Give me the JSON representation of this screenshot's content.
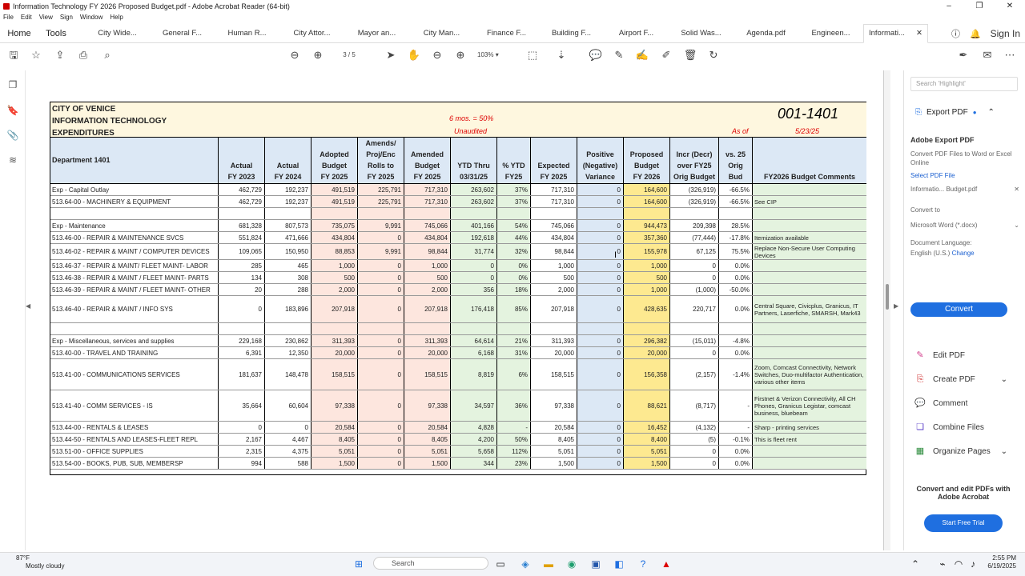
{
  "window": {
    "title": "Information Technology FY 2026 Proposed Budget.pdf - Adobe Acrobat Reader (64-bit)",
    "controls": [
      "–",
      "❐",
      "✕"
    ]
  },
  "menu": [
    "File",
    "Edit",
    "View",
    "Sign",
    "Window",
    "Help"
  ],
  "tabs": {
    "home": "Home",
    "tools": "Tools",
    "items": [
      "City Wide...",
      "General F...",
      "Human R...",
      "City Attor...",
      "Mayor an...",
      "City Man...",
      "Finance F...",
      "Building F...",
      "Airport F...",
      "Solid Was...",
      "Agenda.pdf",
      "Engineen..."
    ],
    "active": "Informati...",
    "sign_in": "Sign In"
  },
  "toolbar": {
    "page_current": "3",
    "page_total": "/ 5",
    "zoom": "103%"
  },
  "right_panel": {
    "search_placeholder": "Search 'Highlight'",
    "export_title": "Export PDF",
    "adobe_export_title": "Adobe Export PDF",
    "adobe_export_desc": "Convert PDF Files to Word or Excel Online",
    "select_file_label": "Select PDF File",
    "selected_file": "Informatio... Budget.pdf",
    "convert_to_label": "Convert to",
    "convert_to_value": "Microsoft Word (*.docx)",
    "doc_lang_label": "Document Language:",
    "doc_lang_value": "English (U.S.)",
    "doc_lang_change": "Change",
    "convert_button": "Convert",
    "tools": [
      "Edit PDF",
      "Create PDF",
      "Comment",
      "Combine Files",
      "Organize Pages"
    ],
    "promo": "Convert and edit PDFs with Adobe Acrobat",
    "trial_button": "Start Free Trial"
  },
  "taskbar": {
    "weather_temp": "87°F",
    "weather_desc": "Mostly cloudy",
    "search": "Search",
    "time": "2:55 PM",
    "date": "6/19/2025"
  },
  "sheet": {
    "org_lines": [
      "CITY OF VENICE",
      "INFORMATION TECHNOLOGY",
      "EXPENDITURES"
    ],
    "half_note": "6 mos. = 50%",
    "unaudited": "Unaudited",
    "dept_code": "001-1401",
    "as_of": "As of",
    "as_of_date": "5/23/25",
    "headers": [
      "Department 1401",
      "Actual\nFY 2023",
      "Actual\nFY 2024",
      "Adopted\nBudget\nFY 2025",
      "Amends/\nProj/Enc\nRolls to\nFY 2025",
      "Amended\nBudget\nFY 2025",
      "YTD Thru\n03/31/25",
      "% YTD\nFY25",
      "Expected\nFY 2025",
      "Positive\n(Negative)\nVariance",
      "Proposed\nBudget\nFY 2026",
      "Incr (Decr)\nover FY25\nOrig Budget",
      "vs. 25\nOrig\nBud",
      "FY2026 Budget Comments"
    ],
    "rows": [
      {
        "cells": [
          "Exp - Capital Outlay",
          "462,729",
          "192,237",
          "491,519",
          "225,791",
          "717,310",
          "263,602",
          "37%",
          "717,310",
          "0",
          "164,600",
          "(326,919)",
          "-66.5%",
          ""
        ]
      },
      {
        "cells": [
          "513.64-00 - MACHINERY & EQUIPMENT",
          "462,729",
          "192,237",
          "491,519",
          "225,791",
          "717,310",
          "263,602",
          "37%",
          "717,310",
          "0",
          "164,600",
          "(326,919)",
          "-66.5%",
          "See CIP"
        ]
      },
      {
        "cells": [
          "",
          "",
          "",
          "",
          "",
          "",
          "",
          "",
          "",
          "",
          "",
          "",
          "",
          ""
        ]
      },
      {
        "cells": [
          "Exp - Maintenance",
          "681,328",
          "807,573",
          "735,075",
          "9,991",
          "745,066",
          "401,166",
          "54%",
          "745,066",
          "0",
          "944,473",
          "209,398",
          "28.5%",
          ""
        ]
      },
      {
        "cells": [
          "513.46-00 - REPAIR & MAINTENANCE SVCS",
          "551,824",
          "471,666",
          "434,804",
          "0",
          "434,804",
          "192,618",
          "44%",
          "434,804",
          "0",
          "357,360",
          "(77,444)",
          "-17.8%",
          "Itemization available"
        ]
      },
      {
        "cells": [
          "513.46-02 - REPAIR & MAINT / COMPUTER DEVICES",
          "109,065",
          "150,950",
          "88,853",
          "9,991",
          "98,844",
          "31,774",
          "32%",
          "98,844",
          "0",
          "155,978",
          "67,125",
          "75.5%",
          "Replace Non-Secure User Computing Devices"
        ]
      },
      {
        "cells": [
          "513.46-37 - REPAIR & MAINT/ FLEET MAINT- LABOR",
          "285",
          "465",
          "1,000",
          "0",
          "1,000",
          "0",
          "0%",
          "1,000",
          "0",
          "1,000",
          "0",
          "0.0%",
          ""
        ]
      },
      {
        "cells": [
          "513.46-38 - REPAIR & MAINT / FLEET MAINT- PARTS",
          "134",
          "308",
          "500",
          "0",
          "500",
          "0",
          "0%",
          "500",
          "0",
          "500",
          "0",
          "0.0%",
          ""
        ]
      },
      {
        "cells": [
          "513.46-39 - REPAIR & MAINT / FLEET MAINT- OTHER",
          "20",
          "288",
          "2,000",
          "0",
          "2,000",
          "356",
          "18%",
          "2,000",
          "0",
          "1,000",
          "(1,000)",
          "-50.0%",
          ""
        ]
      },
      {
        "cells": [
          "513.46-40 - REPAIR & MAINT / INFO SYS",
          "0",
          "183,896",
          "207,918",
          "0",
          "207,918",
          "176,418",
          "85%",
          "207,918",
          "0",
          "428,635",
          "220,717",
          "0.0%",
          "Central Square, Civicplus, Granicus, IT Partners, Laserfiche, SMARSH, Mark43"
        ]
      },
      {
        "cells": [
          "",
          "",
          "",
          "",
          "",
          "",
          "",
          "",
          "",
          "",
          "",
          "",
          "",
          ""
        ]
      },
      {
        "cells": [
          "Exp - Miscellaneous, services and supplies",
          "229,168",
          "230,862",
          "311,393",
          "0",
          "311,393",
          "64,614",
          "21%",
          "311,393",
          "0",
          "296,382",
          "(15,011)",
          "-4.8%",
          ""
        ]
      },
      {
        "cells": [
          "513.40-00 - TRAVEL AND TRAINING",
          "6,391",
          "12,350",
          "20,000",
          "0",
          "20,000",
          "6,168",
          "31%",
          "20,000",
          "0",
          "20,000",
          "0",
          "0.0%",
          ""
        ]
      },
      {
        "cells": [
          "513.41-00 - COMMUNICATIONS SERVICES",
          "181,637",
          "148,478",
          "158,515",
          "0",
          "158,515",
          "8,819",
          "6%",
          "158,515",
          "0",
          "156,358",
          "(2,157)",
          "-1.4%",
          "Zoom, Comcast Connectivity, Network Switches, Duo-multifactor Authentication, various other items"
        ]
      },
      {
        "cells": [
          "513.41-40 - COMM SERVICES - IS",
          "35,664",
          "60,604",
          "97,338",
          "0",
          "97,338",
          "34,597",
          "36%",
          "97,338",
          "0",
          "88,621",
          "(8,717)",
          "-",
          "Firstnet & Verizon Connectivity, All CH Phones, Granicus Legistar, comcast business, bluebeam"
        ]
      },
      {
        "cells": [
          "513.44-00 - RENTALS & LEASES",
          "0",
          "0",
          "20,584",
          "0",
          "20,584",
          "4,828",
          "-",
          "20,584",
          "0",
          "16,452",
          "(4,132)",
          "-",
          "Sharp - printing services"
        ]
      },
      {
        "cells": [
          "513.44-50 - RENTALS AND LEASES-FLEET REPL",
          "2,167",
          "4,467",
          "8,405",
          "0",
          "8,405",
          "4,200",
          "50%",
          "8,405",
          "0",
          "8,400",
          "(5)",
          "-0.1%",
          "This is fleet rent"
        ]
      },
      {
        "cells": [
          "513.51-00 - OFFICE SUPPLIES",
          "2,315",
          "4,375",
          "5,051",
          "0",
          "5,051",
          "5,658",
          "112%",
          "5,051",
          "0",
          "5,051",
          "0",
          "0.0%",
          ""
        ]
      },
      {
        "cells": [
          "513.54-00 - BOOKS, PUB, SUB, MEMBERSP",
          "994",
          "588",
          "1,500",
          "0",
          "1,500",
          "344",
          "23%",
          "1,500",
          "0",
          "1,500",
          "0",
          "0.0%",
          ""
        ]
      }
    ]
  }
}
